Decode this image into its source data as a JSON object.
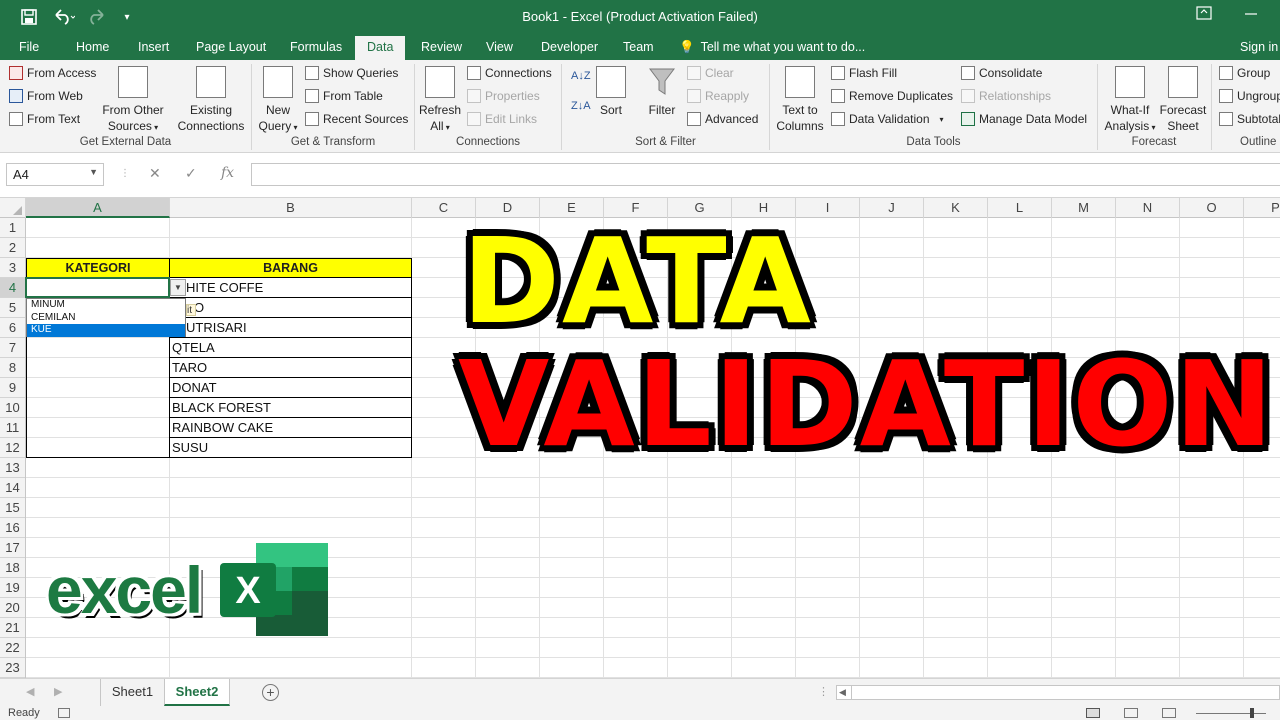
{
  "window": {
    "title": "Book1 - Excel (Product Activation Failed)",
    "accent": "#217346"
  },
  "quick_access": {
    "save_icon": "save-icon",
    "undo_icon": "undo-icon",
    "redo_icon": "redo-icon",
    "customize_icon": "customize-qat-icon"
  },
  "ribbon_tabs": [
    "File",
    "Home",
    "Insert",
    "Page Layout",
    "Formulas",
    "Data",
    "Review",
    "View",
    "Developer",
    "Team"
  ],
  "active_tab": "Data",
  "tell_me": "Tell me what you want to do...",
  "sign_in": "Sign in",
  "ribbon": {
    "get_external": {
      "group_label": "Get External Data",
      "from_access": "From Access",
      "from_web": "From Web",
      "from_text": "From Text",
      "from_other_1": "From Other",
      "from_other_2": "Sources",
      "existing_1": "Existing",
      "existing_2": "Connections"
    },
    "get_transform": {
      "group_label": "Get & Transform",
      "new_query_1": "New",
      "new_query_2": "Query",
      "show_queries": "Show Queries",
      "from_table": "From Table",
      "recent_sources": "Recent Sources"
    },
    "connections": {
      "group_label": "Connections",
      "refresh_1": "Refresh",
      "refresh_2": "All",
      "connections": "Connections",
      "properties": "Properties",
      "edit_links": "Edit Links"
    },
    "sort_filter": {
      "group_label": "Sort & Filter",
      "sort": "Sort",
      "filter": "Filter",
      "clear": "Clear",
      "reapply": "Reapply",
      "advanced": "Advanced"
    },
    "data_tools": {
      "group_label": "Data Tools",
      "text_to_1": "Text to",
      "text_to_2": "Columns",
      "flash_fill": "Flash Fill",
      "remove_duplicates": "Remove Duplicates",
      "data_validation": "Data Validation",
      "consolidate": "Consolidate",
      "relationships": "Relationships",
      "manage_data_model": "Manage Data Model"
    },
    "forecast": {
      "group_label": "Forecast",
      "what_if_1": "What-If",
      "what_if_2": "Analysis",
      "forecast_1": "Forecast",
      "forecast_2": "Sheet"
    },
    "outline": {
      "group_label": "Outline",
      "group": "Group",
      "ungroup": "Ungroup",
      "subtotal": "Subtotal"
    }
  },
  "formula_bar": {
    "name_box": "A4",
    "cancel": "✕",
    "enter": "✓",
    "fx": "fx",
    "value": ""
  },
  "columns": [
    "A",
    "B",
    "C",
    "D",
    "E",
    "F",
    "G",
    "H",
    "I",
    "J",
    "K",
    "L",
    "M",
    "N",
    "O",
    "P"
  ],
  "rows": [
    "1",
    "2",
    "3",
    "4",
    "5",
    "6",
    "7",
    "8",
    "9",
    "10",
    "11",
    "12",
    "13",
    "14",
    "15",
    "16",
    "17",
    "18",
    "19",
    "20",
    "21",
    "22",
    "23"
  ],
  "table": {
    "header_kategori": "KATEGORI",
    "header_barang": "BARANG",
    "header_fill": "#ffff00",
    "barang": [
      "HITE COFFE",
      "O",
      "UTRISARI",
      "QTELA",
      "TARO",
      "DONAT",
      "BLACK FOREST",
      "RAINBOW CAKE",
      "SUSU"
    ]
  },
  "dropdown": {
    "options": [
      "MINUM",
      "CEMILAN",
      "KUE"
    ],
    "selected": "KUE",
    "peek_cell_text": "it"
  },
  "overlay": {
    "line1": "DATA",
    "line2": "VALIDATION",
    "line1_color": "#ffff00",
    "line2_color": "#ff0000",
    "logo_word": "excel",
    "logo_letter": "X"
  },
  "sheets": [
    "Sheet1",
    "Sheet2"
  ],
  "active_sheet": "Sheet2",
  "status": {
    "ready": "Ready"
  }
}
